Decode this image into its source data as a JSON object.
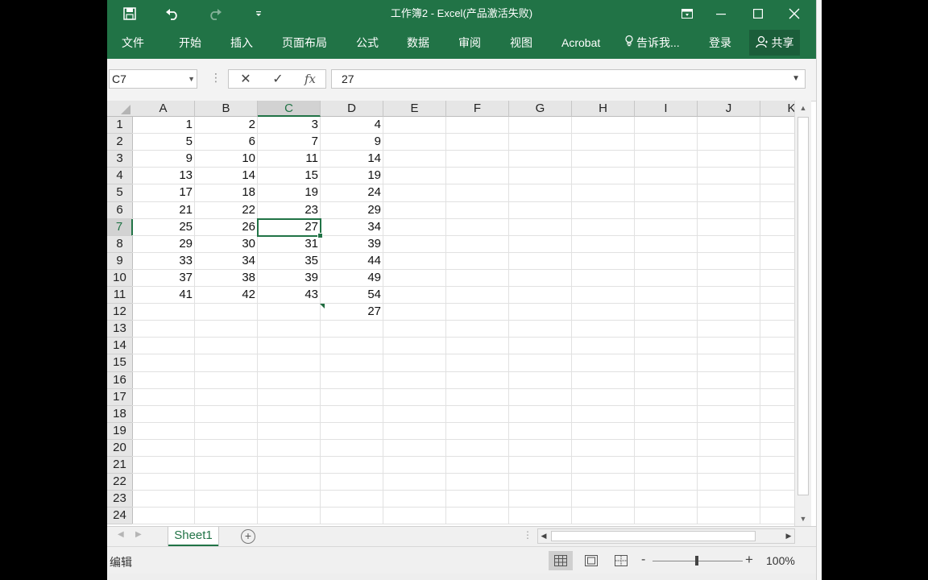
{
  "title": "工作簿2 - Excel(产品激活失败)",
  "ribbon_tabs": [
    "文件",
    "开始",
    "插入",
    "页面布局",
    "公式",
    "数据",
    "审阅",
    "视图",
    "Acrobat",
    "告诉我...",
    "登录"
  ],
  "share_label": "共享",
  "name_box": "C7",
  "formula_value": "27",
  "fx_label": "fx",
  "columns": [
    "A",
    "B",
    "C",
    "D",
    "E",
    "F",
    "G",
    "H",
    "I",
    "J",
    "K"
  ],
  "selected_column": "C",
  "rows": [
    "1",
    "2",
    "3",
    "4",
    "5",
    "6",
    "7",
    "8",
    "9",
    "10",
    "11",
    "12",
    "13",
    "14",
    "15",
    "16",
    "17",
    "18",
    "19",
    "20",
    "21",
    "22",
    "23",
    "24"
  ],
  "selected_row": "7",
  "cells": [
    [
      "1",
      "2",
      "3",
      "4"
    ],
    [
      "5",
      "6",
      "7",
      "9"
    ],
    [
      "9",
      "10",
      "11",
      "14"
    ],
    [
      "13",
      "14",
      "15",
      "19"
    ],
    [
      "17",
      "18",
      "19",
      "24"
    ],
    [
      "21",
      "22",
      "23",
      "29"
    ],
    [
      "25",
      "26",
      "27",
      "34"
    ],
    [
      "29",
      "30",
      "31",
      "39"
    ],
    [
      "33",
      "34",
      "35",
      "44"
    ],
    [
      "37",
      "38",
      "39",
      "49"
    ],
    [
      "41",
      "42",
      "43",
      "54"
    ],
    [
      "",
      "",
      "",
      "27"
    ]
  ],
  "sheet_tab": "Sheet1",
  "status_mode": "编辑",
  "zoom": "100%",
  "accent_color": "#217346"
}
